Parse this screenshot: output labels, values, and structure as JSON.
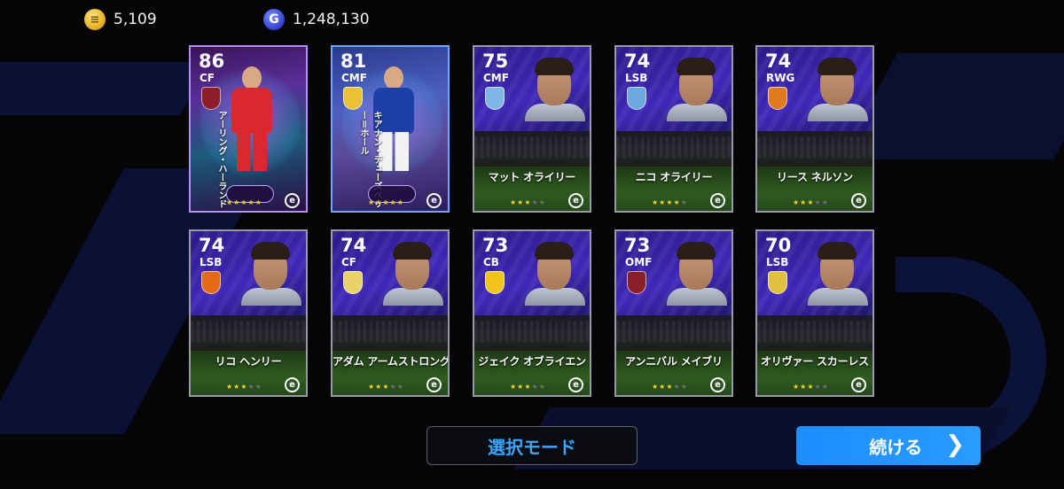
{
  "currency": {
    "coins": "5,109",
    "gp": "1,248,130",
    "coin_icon": "coin-icon",
    "gp_icon": "gp-icon",
    "gp_letter": "G"
  },
  "cards": [
    {
      "rating": "86",
      "position": "CF",
      "name": "アーリング・ハーランド",
      "stars": 5,
      "featured": true,
      "jersey": "red"
    },
    {
      "rating": "81",
      "position": "CMF",
      "name": "キアナン・デューズベリー＝ホール",
      "stars": 5,
      "featured": true,
      "jersey": "blue"
    },
    {
      "rating": "75",
      "position": "CMF",
      "name": "マット オライリー",
      "stars": 3,
      "crest_color": "#7fb6e8"
    },
    {
      "rating": "74",
      "position": "LSB",
      "name": "ニコ オライリー",
      "stars": 4,
      "crest_color": "#6aa8df"
    },
    {
      "rating": "74",
      "position": "RWG",
      "name": "リース ネルソン",
      "stars": 3,
      "crest_color": "#e07a1e"
    },
    {
      "rating": "74",
      "position": "LSB",
      "name": "リコ ヘンリー",
      "stars": 3,
      "crest_color": "#e36a17"
    },
    {
      "rating": "74",
      "position": "CF",
      "name": "アダム アームストロング",
      "stars": 3,
      "crest_color": "#e9d26a"
    },
    {
      "rating": "73",
      "position": "CB",
      "name": "ジェイク オブライエン",
      "stars": 3,
      "crest_color": "#f0c419"
    },
    {
      "rating": "73",
      "position": "OMF",
      "name": "アンニバル メイブリ",
      "stars": 3,
      "crest_color": "#8a1f2b"
    },
    {
      "rating": "70",
      "position": "LSB",
      "name": "オリヴァー スカーレス",
      "stars": 3,
      "crest_color": "#e0c040"
    }
  ],
  "buttons": {
    "mode": "選択モード",
    "continue": "続ける",
    "continue_icon": "chevron-right-icon"
  },
  "efootball_mark": "e"
}
